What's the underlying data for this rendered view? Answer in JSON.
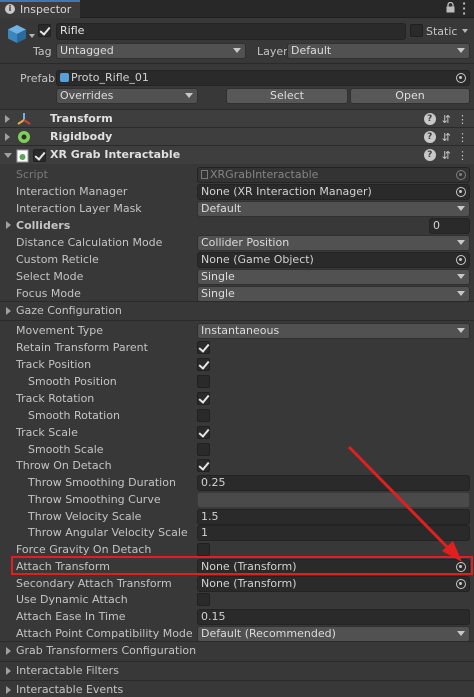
{
  "tab": {
    "title": "Inspector"
  },
  "header": {
    "object_name": "Rifle",
    "static_label": "Static",
    "tag_label": "Tag",
    "tag_value": "Untagged",
    "layer_label": "Layer",
    "layer_value": "Default",
    "prefab_label": "Prefab",
    "prefab_value": "Proto_Rifle_01",
    "overrides_label": "Overrides",
    "select_label": "Select",
    "open_label": "Open"
  },
  "components": {
    "transform": "Transform",
    "rigidbody": "Rigidbody",
    "xr_grab": "XR Grab Interactable"
  },
  "fields": {
    "script_label": "Script",
    "script_value": "XRGrabInteractable",
    "interaction_manager_label": "Interaction Manager",
    "interaction_manager_value": "None (XR Interaction Manager)",
    "interaction_layer_mask_label": "Interaction Layer Mask",
    "interaction_layer_mask_value": "Default",
    "colliders_label": "Colliders",
    "colliders_count": "0",
    "distance_calc_label": "Distance Calculation Mode",
    "distance_calc_value": "Collider Position",
    "custom_reticle_label": "Custom Reticle",
    "custom_reticle_value": "None (Game Object)",
    "select_mode_label": "Select Mode",
    "select_mode_value": "Single",
    "focus_mode_label": "Focus Mode",
    "focus_mode_value": "Single",
    "gaze_config_label": "Gaze Configuration",
    "movement_type_label": "Movement Type",
    "movement_type_value": "Instantaneous",
    "retain_parent_label": "Retain Transform Parent",
    "track_position_label": "Track Position",
    "smooth_position_label": "Smooth Position",
    "track_rotation_label": "Track Rotation",
    "smooth_rotation_label": "Smooth Rotation",
    "track_scale_label": "Track Scale",
    "smooth_scale_label": "Smooth Scale",
    "throw_on_detach_label": "Throw On Detach",
    "throw_smoothing_duration_label": "Throw Smoothing Duration",
    "throw_smoothing_duration_value": "0.25",
    "throw_smoothing_curve_label": "Throw Smoothing Curve",
    "throw_velocity_scale_label": "Throw Velocity Scale",
    "throw_velocity_scale_value": "1.5",
    "throw_angular_label": "Throw Angular Velocity Scale",
    "throw_angular_value": "1",
    "force_gravity_label": "Force Gravity On Detach",
    "attach_transform_label": "Attach Transform",
    "attach_transform_value": "None (Transform)",
    "secondary_attach_label": "Secondary Attach Transform",
    "secondary_attach_value": "None (Transform)",
    "use_dynamic_attach_label": "Use Dynamic Attach",
    "attach_ease_label": "Attach Ease In Time",
    "attach_ease_value": "0.15",
    "attach_compat_label": "Attach Point Compatibility Mode",
    "attach_compat_value": "Default (Recommended)",
    "grab_transformers_label": "Grab Transformers Configuration",
    "interactable_filters_label": "Interactable Filters",
    "interactable_events_label": "Interactable Events"
  },
  "colors": {
    "highlight": "#e02020",
    "arrow": "#e02020",
    "background": "#383838"
  }
}
